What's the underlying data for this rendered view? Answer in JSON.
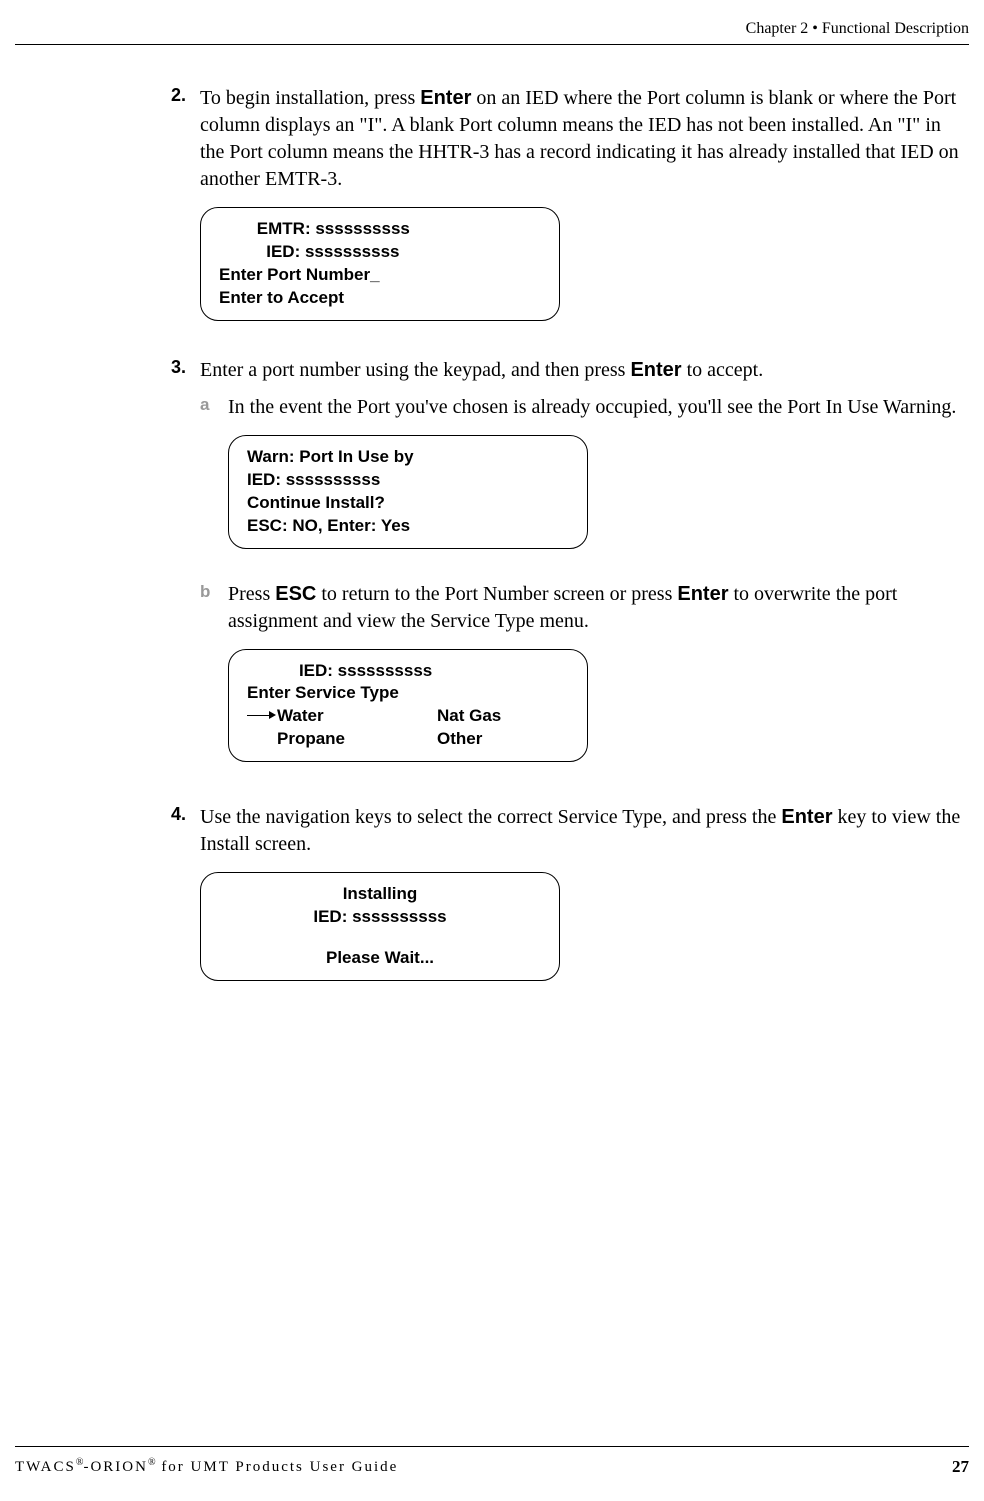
{
  "header": {
    "chapter": "Chapter 2 • Functional Description"
  },
  "steps": {
    "s2": {
      "num": "2.",
      "text_before": "To begin installation, press ",
      "enter": "Enter",
      "text_after": " on an IED where the Port column is blank or where the Port column displays an \"I\". A blank Port column means the IED has not been installed. An \"I\" in the Port column means the HHTR-3 has a record indicating it has already installed that IED on another EMTR-3."
    },
    "s2_display": {
      "line1": "        EMTR: ssssssssss",
      "line2": "          IED: ssssssssss",
      "line3": "Enter Port Number_",
      "line4": "Enter to Accept"
    },
    "s3": {
      "num": "3.",
      "text_before": "Enter a port number using the keypad, and then press ",
      "enter": "Enter",
      "text_after": " to accept."
    },
    "s3a": {
      "letter": "a",
      "text": "In the event the Port you've chosen is already occupied, you'll see the Port In Use Warning."
    },
    "s3a_display": {
      "line1": "Warn: Port In Use by",
      "line2": "IED: ssssssssss",
      "line3": "Continue Install?",
      "line4": "ESC: NO, Enter: Yes"
    },
    "s3b": {
      "letter": "b",
      "t1": "Press ",
      "esc": "ESC",
      "t2": " to return to the Port Number screen or press ",
      "enter": "Enter",
      "t3": " to overwrite the port assignment and view the Service Type menu."
    },
    "s3b_display": {
      "line1": "           IED: ssssssssss",
      "line2": "Enter Service Type",
      "opt1": "Water",
      "opt2": "Nat Gas",
      "opt3": "Propane",
      "opt4": "Other"
    },
    "s4": {
      "num": "4.",
      "t1": "Use the navigation keys to select the correct Service Type, and press the ",
      "enter": "Enter",
      "t2": " key to view the Install screen."
    },
    "s4_display": {
      "line1": "Installing",
      "line2": "IED: ssssssssss",
      "line3": "Please Wait..."
    }
  },
  "footer": {
    "brand_1": "TWACS",
    "reg": "®",
    "dash": "-ORION",
    "tail": " for UMT Products User Guide",
    "page": "27"
  }
}
